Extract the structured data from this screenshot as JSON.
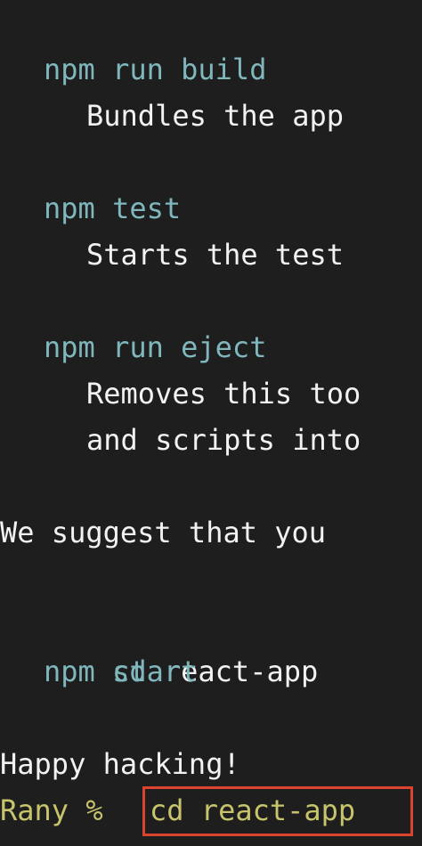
{
  "terminal": {
    "colors": {
      "background": "#1e1e1e",
      "command": "#7fb7bd",
      "text": "#f2f2f2",
      "prompt": "#c7c46c",
      "highlight": "#d9432f"
    },
    "lines": {
      "build_cmd": "npm run build",
      "build_desc": "Bundles the app",
      "test_cmd": "npm test",
      "test_desc": "Starts the test",
      "eject_cmd": "npm run eject",
      "eject_desc1": "Removes this too",
      "eject_desc2": "and scripts into",
      "suggest": "We suggest that you",
      "cd_prefix": "cd",
      "cd_arg": " react-app",
      "start_cmd": "npm start",
      "happy": "Happy hacking!",
      "prompt": "Rany %",
      "typed_command": "cd react-app"
    }
  }
}
